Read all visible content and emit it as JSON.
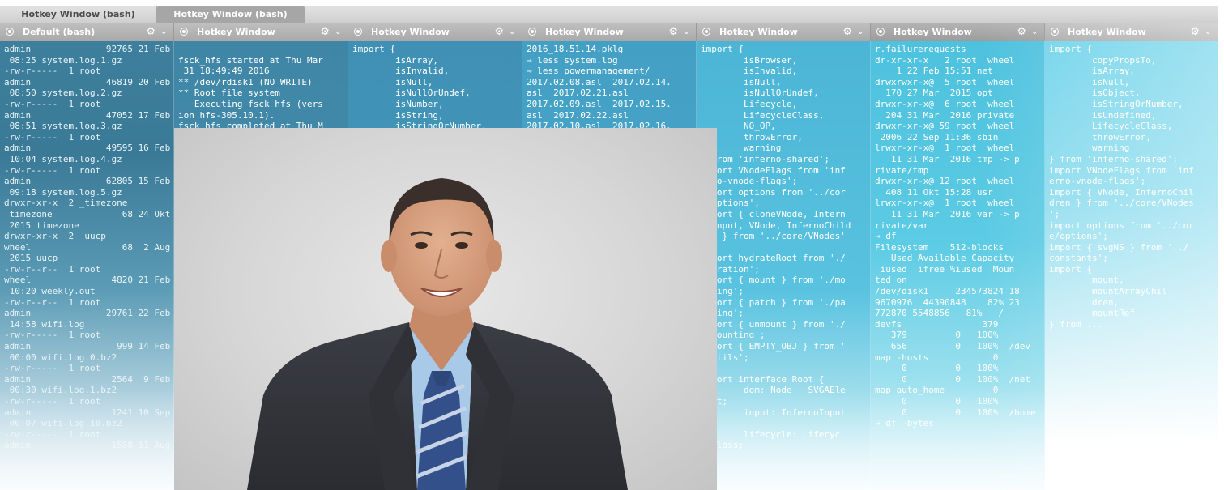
{
  "tabs": [
    {
      "label": "Hotkey Window (bash)",
      "active": false
    },
    {
      "label": "Hotkey Window (bash)",
      "active": true
    }
  ],
  "panes": [
    {
      "title": "Default (bash)",
      "text": "admin              92765 21 Feb\n 08:25 system.log.1.gz\n-rw-r-----  1 root\nadmin              46819 20 Feb\n 08:50 system.log.2.gz\n-rw-r-----  1 root\nadmin              47052 17 Feb\n 08:51 system.log.3.gz\n-rw-r-----  1 root\nadmin              49595 16 Feb\n 10:04 system.log.4.gz\n-rw-r-----  1 root\nadmin              62805 15 Feb\n 09:18 system.log.5.gz\ndrwxr-xr-x  2 _timezone\n_timezone             68 24 Okt\n 2015 timezone\ndrwxr-xr-x  2 _uucp\nwheel                 68  2 Aug\n 2015 uucp\n-rw-r--r--  1 root\nwheel               4820 21 Feb\n 10:20 weekly.out\n-rw-r--r--  1 root\nadmin              29761 22 Feb\n 14:58 wifi.log\n-rw-r-----  1 root\nadmin                999 14 Feb\n 00:00 wifi.log.0.bz2\n-rw-r-----  1 root\nadmin               2564  9 Feb\n 00:30 wifi.log.1.bz2\n-rw-r-----  1 root\nadmin               1241 10 Sep\n 00:07 wifi.log.10.bz2\n-rw-r-----  1 root\nadmin               1588 11 Aug"
    },
    {
      "title": "Hotkey Window",
      "text": "\nfsck_hfs started at Thu Mar\n 31 18:49:49 2016\n** /dev/rdisk1 (NO WRITE)\n** Root file system\n   Executing fsck_hfs (vers\nion hfs-305.10.1).\nfsck_hfs completed at Thu M"
    },
    {
      "title": "Hotkey Window",
      "text": "import {\n        isArray,\n        isInvalid,\n        isNull,\n        isNullOrUndef,\n        isNumber,\n        isString,\n        isStringOrNumber,"
    },
    {
      "title": "Hotkey Window",
      "text": "2016_18.51.14.pklg\n→ less system.log\n→ less powermanagement/\n2017.02.08.asl  2017.02.14.\nasl  2017.02.21.asl\n2017.02.09.asl  2017.02.15.\nasl  2017.02.22.asl\n2017.02.10.asl  2017.02.16."
    },
    {
      "title": "Hotkey Window",
      "text": "import {\n        isBrowser,\n        isInvalid,\n        isNull,\n        isNullOrUndef,\n        Lifecycle,\n        LifecycleClass,\n        NO_OP,\n        throwError,\n        warning\n} from 'inferno-shared';\nimport VNodeFlags from 'inf\nerno-vnode-flags';\nimport options from '../cor\ne/options';\nimport { cloneVNode, Intern\nalInput, VNode, InfernoChild\nren } from '../core/VNodes'\n;\nimport hydrateRoot from './\nhydration';\nimport { mount } from './mo\nunting';\nimport { patch } from './pa\ntching';\nimport { unmount } from './\nunmounting';\nimport { EMPTY_OBJ } from '\n./utils';\n\nexport interface Root {\n        dom: Node | SVGAEle\nment;\n        input: InfernoInput\n;\n        lifecycle: Lifecyc\nleClass;"
    },
    {
      "title": "Hotkey Window",
      "text": "r.failurerequests\ndr-xr-xr-x   2 root  wheel\n    1 22 Feb 15:51 net\ndrwxrwxr-x@  5 root  wheel\n  170 27 Mar  2015 opt\ndrwxr-xr-x@  6 root  wheel\n  204 31 Mar  2016 private\ndrwxr-xr-x@ 59 root  wheel\n 2006 22 Sep 11:36 sbin\nlrwxr-xr-x@  1 root  wheel\n   11 31 Mar  2016 tmp -> p\nrivate/tmp\ndrwxr-xr-x@ 12 root  wheel\n  408 11 Okt 15:28 usr\nlrwxr-xr-x@  1 root  wheel\n   11 31 Mar  2016 var -> p\nrivate/var\n→ df\nFilesystem    512-blocks\n   Used Available Capacity\n iused  ifree %iused  Moun\nted on\n/dev/disk1     234573824 18\n9670976  44390848    82% 23\n772870 5548856   81%   /\ndevfs               379\n   379         0   100%\n   656         0   100%  /dev\nmap -hosts            0\n     0         0   100%\n     0         0   100%  /net\nmap auto_home         0\n     0         0   100%\n     0         0   100%  /home\n→ df -bytes"
    },
    {
      "title": "Hotkey Window",
      "text": "import {\n        copyPropsTo,\n        isArray,\n        isNull,\n        isObject,\n        isStringOrNumber,\n        isUndefined,\n        LifecycleClass,\n        throwError,\n        warning\n} from 'inferno-shared';\nimport VNodeFlags from 'inf\nerno-vnode-flags';\nimport { VNode, InfernoChil\ndren } from '../core/VNodes\n';\nimport options from '../cor\ne/options';\nimport { svgNS } from '../\nconstants';\nimport {\n        mount,\n        mountArrayChil\n        dren,\n        mountRef\n} from ..."
    }
  ]
}
